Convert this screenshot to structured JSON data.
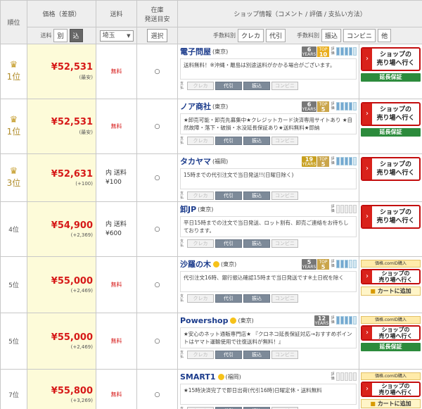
{
  "header": {
    "rank": "順位",
    "price": "価格（差額）",
    "shipping": "送料",
    "stock_line1": "在庫",
    "stock_line2": "発送目安",
    "shop_info": "ショップ情報（コメント / 評価 / 支払い方法）",
    "shipping_sub": "送料",
    "toggle_separate": "別",
    "toggle_included": "込",
    "prefecture": "埼玉",
    "select_button": "選択",
    "fee_label_1": "手数料別",
    "fee_tab_credit": "クレカ",
    "fee_tab_cod": "代引",
    "fee_label_2": "手数料別",
    "fee_tab_transfer": "振込",
    "fee_tab_convenience": "コンビニ",
    "fee_tab_other": "他"
  },
  "labels": {
    "pay_label": "支払",
    "pay_credit": "クレカ",
    "pay_cod": "代引",
    "pay_transfer": "振込",
    "pay_convenience": "コンビニ",
    "go_button": "ショップの 売り場へ行く",
    "go_line1": "ショップの",
    "go_line2": "売り場へ行く",
    "extend": "延長保証",
    "id_purchase": "価格.comID購入",
    "cart": "カートに追加",
    "years": "YEARS",
    "top": "TOP",
    "eval": "評価",
    "stock_mark": "○"
  },
  "colors": {
    "price": "#d61918",
    "shop_link": "#1c3c8c",
    "go_border": "#c30d0d",
    "extend": "#2c8b3c"
  },
  "rows": [
    {
      "rank": "1位",
      "crown": true,
      "price": "¥52,531",
      "diff": "(最安)",
      "ship": "無料",
      "ship_free": true,
      "stock": "○",
      "name": "電子問屋",
      "loc": "(東京)",
      "smile": false,
      "years": "6",
      "years_gold": false,
      "top": "10",
      "comment": "送料無料！※沖縄・離島は別途送料がかかる場合がございます。",
      "pays": [
        false,
        true,
        true,
        false
      ],
      "mode": "full",
      "eval_filled": 4
    },
    {
      "rank": "1位",
      "crown": true,
      "price": "¥52,531",
      "diff": "(最安)",
      "ship": "無料",
      "ship_free": true,
      "stock": "○",
      "name": "ノア商社",
      "loc": "(東京)",
      "smile": false,
      "years": "6",
      "years_gold": false,
      "top": "5",
      "comment": "★卸売可能・卸売先募集中★クレジットカード決済専用サイトあり ★自然故障・落下・破損・水没延長保証あり★送料無料★即納",
      "pays": [
        false,
        true,
        true,
        false
      ],
      "mode": "full",
      "eval_filled": 4
    },
    {
      "rank": "3位",
      "crown": true,
      "price": "¥52,631",
      "diff": "(+100)",
      "ship": "内 送料 ¥100",
      "ship_free": false,
      "stock": "○",
      "name": "タカヤマ",
      "loc": "(福岡)",
      "smile": false,
      "years": "19",
      "years_gold": true,
      "top": "5",
      "comment": "15時までの代引注文で当日発送!!(日曜日除く)",
      "pays": [
        false,
        true,
        true,
        false
      ],
      "mode": "go",
      "eval_filled": 4
    },
    {
      "rank": "4位",
      "crown": false,
      "price": "¥54,900",
      "diff": "(+2,369)",
      "ship": "内 送料 ¥600",
      "ship_free": false,
      "stock": "○",
      "name": "卸JP",
      "loc": "(東京)",
      "smile": false,
      "years": "",
      "years_gold": false,
      "top": "",
      "comment": "平日15時までの注文で当日発送、ロット割有、卸売ご連絡をお待ちしております。",
      "pays": [
        false,
        true,
        true,
        false
      ],
      "mode": "go",
      "eval_filled": 0
    },
    {
      "rank": "5位",
      "crown": false,
      "price": "¥55,000",
      "diff": "(+2,469)",
      "ship": "無料",
      "ship_free": true,
      "stock": "○",
      "name": "沙羅の木",
      "loc": "(東京)",
      "smile": true,
      "years": "5",
      "years_gold": false,
      "top": "5",
      "comment": "代引注文16時、銀行振込確認15時まで当日発送です※土日祝を除く",
      "pays": [
        false,
        true,
        true,
        false
      ],
      "mode": "cart",
      "eval_filled": 3
    },
    {
      "rank": "5位",
      "crown": false,
      "price": "¥55,000",
      "diff": "(+2,469)",
      "ship": "無料",
      "ship_free": true,
      "stock": "○",
      "name": "Powershop",
      "loc": "(東京)",
      "smile": true,
      "years": "12",
      "years_gold": false,
      "top": "",
      "comment": "★安心のネット通販専門店★ 『クロネコ延長保証対応→おすすめポイントはヤマト運輸使用で往復送料が無料！』",
      "pays": [
        false,
        true,
        true,
        false
      ],
      "mode": "cartext",
      "eval_filled": 4
    },
    {
      "rank": "7位",
      "crown": false,
      "price": "¥55,800",
      "diff": "(+3,269)",
      "ship": "無料",
      "ship_free": true,
      "stock": "○",
      "name": "SMART1",
      "loc": "(福岡)",
      "smile": true,
      "years": "",
      "years_gold": false,
      "top": "",
      "comment": "★15時決済完了で即日出荷(代引16時)日曜定休・送料無料",
      "pays": [
        false,
        true,
        true,
        false
      ],
      "mode": "cart",
      "eval_filled": 0
    }
  ]
}
